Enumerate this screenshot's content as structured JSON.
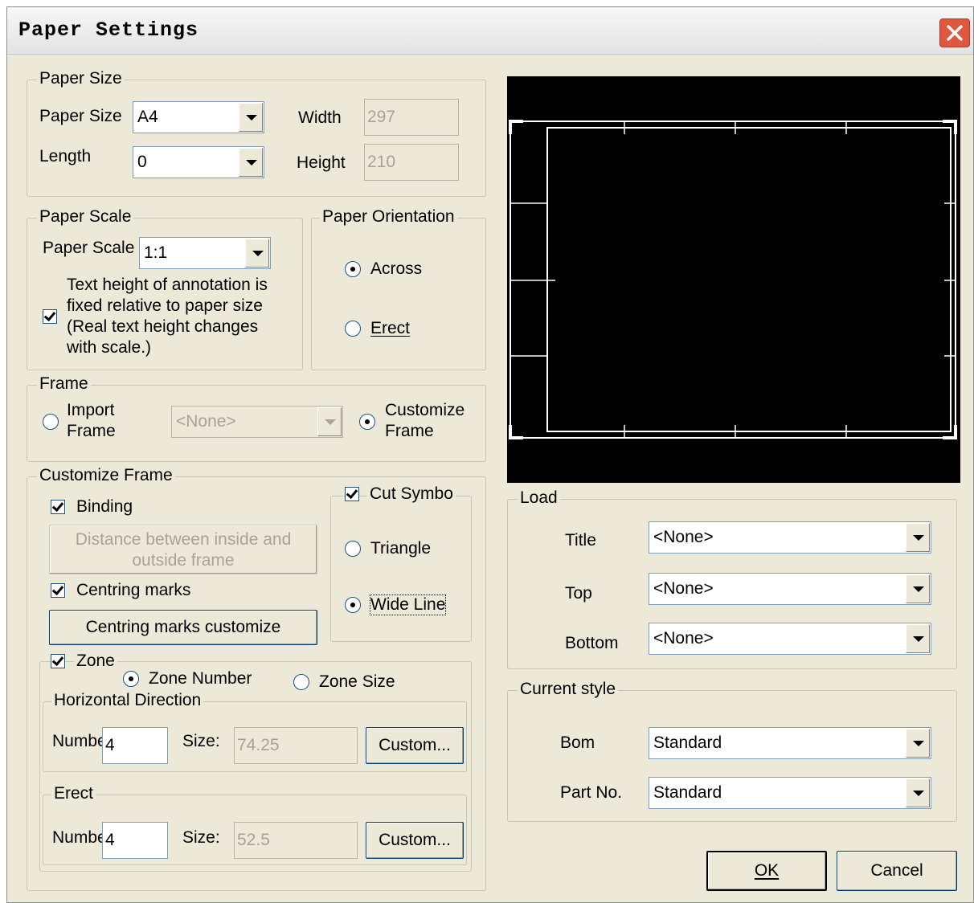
{
  "window": {
    "title": "Paper Settings"
  },
  "paper_size_group": {
    "legend": "Paper Size",
    "paper_size_label": "Paper Size",
    "paper_size_value": "A4",
    "length_label": "Length",
    "length_value": "0",
    "width_label": "Width",
    "width_value": "297",
    "height_label": "Height",
    "height_value": "210"
  },
  "paper_scale_group": {
    "legend": "Paper Scale",
    "paper_scale_label": "Paper Scale",
    "paper_scale_value": "1:1",
    "fixed_text": {
      "checked": true,
      "line1": "Text height of annotation is",
      "line2": "fixed relative to paper size",
      "line3": "(Real text height changes",
      "line4": "with scale.)"
    }
  },
  "orientation_group": {
    "legend": "Paper Orientation",
    "across_label": "Across",
    "erect_label": "Erect",
    "selected": "Across"
  },
  "frame_group": {
    "legend": "Frame",
    "import_line1": "Import",
    "import_line2": "Frame",
    "frame_combo_value": "<None>",
    "customize_line1": "Customize",
    "customize_line2": "Frame",
    "selected": "Customize Frame"
  },
  "customize_frame_group": {
    "legend": "Customize Frame",
    "binding_label": "Binding",
    "binding_checked": true,
    "distance_button_line1": "Distance between inside and",
    "distance_button_line2": "outside frame",
    "centring_label": "Centring marks",
    "centring_checked": true,
    "centring_customize_button": "Centring marks customize",
    "cut_symbol": {
      "legend": "Cut Symbo",
      "checked": true,
      "triangle_label": "Triangle",
      "wide_line_label": "Wide Line",
      "selected": "Wide Line"
    },
    "zone": {
      "legend": "Zone",
      "checked": true,
      "zone_number_label": "Zone Number",
      "zone_size_label": "Zone Size",
      "selected": "Zone Number",
      "horizontal": {
        "legend": "Horizontal Direction",
        "number_label": "Numbe",
        "number_value": "4",
        "size_label": "Size:",
        "size_value": "74.25",
        "custom_button": "Custom..."
      },
      "erect": {
        "legend": "Erect",
        "number_label": "Numbe",
        "number_value": "4",
        "size_label": "Size:",
        "size_value": "52.5",
        "custom_button": "Custom..."
      }
    }
  },
  "load_group": {
    "legend": "Load",
    "title_label": "Title",
    "title_value": "<None>",
    "top_label": "Top",
    "top_value": "<None>",
    "bottom_label": "Bottom",
    "bottom_value": "<None>"
  },
  "current_style_group": {
    "legend": "Current style",
    "bom_label": "Bom",
    "bom_value": "Standard",
    "part_no_label": "Part No.",
    "part_no_value": "Standard"
  },
  "buttons": {
    "ok": "OK",
    "cancel": "Cancel"
  },
  "colors": {
    "dialog_bg": "#ece9d8",
    "close_button": "#e0563f",
    "preview_bg": "#000000",
    "preview_lines": "#ffffff"
  }
}
